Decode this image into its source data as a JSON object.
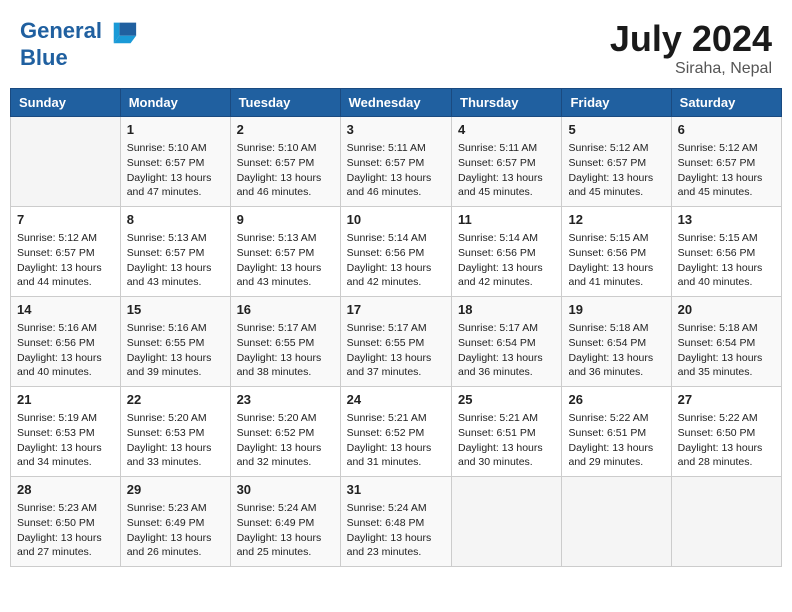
{
  "header": {
    "logo_line1": "General",
    "logo_line2": "Blue",
    "month_year": "July 2024",
    "location": "Siraha, Nepal"
  },
  "days_of_week": [
    "Sunday",
    "Monday",
    "Tuesday",
    "Wednesday",
    "Thursday",
    "Friday",
    "Saturday"
  ],
  "weeks": [
    [
      {
        "day": "",
        "sunrise": "",
        "sunset": "",
        "daylight": "",
        "empty": true
      },
      {
        "day": "1",
        "sunrise": "Sunrise: 5:10 AM",
        "sunset": "Sunset: 6:57 PM",
        "daylight": "Daylight: 13 hours and 47 minutes."
      },
      {
        "day": "2",
        "sunrise": "Sunrise: 5:10 AM",
        "sunset": "Sunset: 6:57 PM",
        "daylight": "Daylight: 13 hours and 46 minutes."
      },
      {
        "day": "3",
        "sunrise": "Sunrise: 5:11 AM",
        "sunset": "Sunset: 6:57 PM",
        "daylight": "Daylight: 13 hours and 46 minutes."
      },
      {
        "day": "4",
        "sunrise": "Sunrise: 5:11 AM",
        "sunset": "Sunset: 6:57 PM",
        "daylight": "Daylight: 13 hours and 45 minutes."
      },
      {
        "day": "5",
        "sunrise": "Sunrise: 5:12 AM",
        "sunset": "Sunset: 6:57 PM",
        "daylight": "Daylight: 13 hours and 45 minutes."
      },
      {
        "day": "6",
        "sunrise": "Sunrise: 5:12 AM",
        "sunset": "Sunset: 6:57 PM",
        "daylight": "Daylight: 13 hours and 45 minutes."
      }
    ],
    [
      {
        "day": "7",
        "sunrise": "Sunrise: 5:12 AM",
        "sunset": "Sunset: 6:57 PM",
        "daylight": "Daylight: 13 hours and 44 minutes."
      },
      {
        "day": "8",
        "sunrise": "Sunrise: 5:13 AM",
        "sunset": "Sunset: 6:57 PM",
        "daylight": "Daylight: 13 hours and 43 minutes."
      },
      {
        "day": "9",
        "sunrise": "Sunrise: 5:13 AM",
        "sunset": "Sunset: 6:57 PM",
        "daylight": "Daylight: 13 hours and 43 minutes."
      },
      {
        "day": "10",
        "sunrise": "Sunrise: 5:14 AM",
        "sunset": "Sunset: 6:56 PM",
        "daylight": "Daylight: 13 hours and 42 minutes."
      },
      {
        "day": "11",
        "sunrise": "Sunrise: 5:14 AM",
        "sunset": "Sunset: 6:56 PM",
        "daylight": "Daylight: 13 hours and 42 minutes."
      },
      {
        "day": "12",
        "sunrise": "Sunrise: 5:15 AM",
        "sunset": "Sunset: 6:56 PM",
        "daylight": "Daylight: 13 hours and 41 minutes."
      },
      {
        "day": "13",
        "sunrise": "Sunrise: 5:15 AM",
        "sunset": "Sunset: 6:56 PM",
        "daylight": "Daylight: 13 hours and 40 minutes."
      }
    ],
    [
      {
        "day": "14",
        "sunrise": "Sunrise: 5:16 AM",
        "sunset": "Sunset: 6:56 PM",
        "daylight": "Daylight: 13 hours and 40 minutes."
      },
      {
        "day": "15",
        "sunrise": "Sunrise: 5:16 AM",
        "sunset": "Sunset: 6:55 PM",
        "daylight": "Daylight: 13 hours and 39 minutes."
      },
      {
        "day": "16",
        "sunrise": "Sunrise: 5:17 AM",
        "sunset": "Sunset: 6:55 PM",
        "daylight": "Daylight: 13 hours and 38 minutes."
      },
      {
        "day": "17",
        "sunrise": "Sunrise: 5:17 AM",
        "sunset": "Sunset: 6:55 PM",
        "daylight": "Daylight: 13 hours and 37 minutes."
      },
      {
        "day": "18",
        "sunrise": "Sunrise: 5:17 AM",
        "sunset": "Sunset: 6:54 PM",
        "daylight": "Daylight: 13 hours and 36 minutes."
      },
      {
        "day": "19",
        "sunrise": "Sunrise: 5:18 AM",
        "sunset": "Sunset: 6:54 PM",
        "daylight": "Daylight: 13 hours and 36 minutes."
      },
      {
        "day": "20",
        "sunrise": "Sunrise: 5:18 AM",
        "sunset": "Sunset: 6:54 PM",
        "daylight": "Daylight: 13 hours and 35 minutes."
      }
    ],
    [
      {
        "day": "21",
        "sunrise": "Sunrise: 5:19 AM",
        "sunset": "Sunset: 6:53 PM",
        "daylight": "Daylight: 13 hours and 34 minutes."
      },
      {
        "day": "22",
        "sunrise": "Sunrise: 5:20 AM",
        "sunset": "Sunset: 6:53 PM",
        "daylight": "Daylight: 13 hours and 33 minutes."
      },
      {
        "day": "23",
        "sunrise": "Sunrise: 5:20 AM",
        "sunset": "Sunset: 6:52 PM",
        "daylight": "Daylight: 13 hours and 32 minutes."
      },
      {
        "day": "24",
        "sunrise": "Sunrise: 5:21 AM",
        "sunset": "Sunset: 6:52 PM",
        "daylight": "Daylight: 13 hours and 31 minutes."
      },
      {
        "day": "25",
        "sunrise": "Sunrise: 5:21 AM",
        "sunset": "Sunset: 6:51 PM",
        "daylight": "Daylight: 13 hours and 30 minutes."
      },
      {
        "day": "26",
        "sunrise": "Sunrise: 5:22 AM",
        "sunset": "Sunset: 6:51 PM",
        "daylight": "Daylight: 13 hours and 29 minutes."
      },
      {
        "day": "27",
        "sunrise": "Sunrise: 5:22 AM",
        "sunset": "Sunset: 6:50 PM",
        "daylight": "Daylight: 13 hours and 28 minutes."
      }
    ],
    [
      {
        "day": "28",
        "sunrise": "Sunrise: 5:23 AM",
        "sunset": "Sunset: 6:50 PM",
        "daylight": "Daylight: 13 hours and 27 minutes."
      },
      {
        "day": "29",
        "sunrise": "Sunrise: 5:23 AM",
        "sunset": "Sunset: 6:49 PM",
        "daylight": "Daylight: 13 hours and 26 minutes."
      },
      {
        "day": "30",
        "sunrise": "Sunrise: 5:24 AM",
        "sunset": "Sunset: 6:49 PM",
        "daylight": "Daylight: 13 hours and 25 minutes."
      },
      {
        "day": "31",
        "sunrise": "Sunrise: 5:24 AM",
        "sunset": "Sunset: 6:48 PM",
        "daylight": "Daylight: 13 hours and 23 minutes."
      },
      {
        "day": "",
        "empty": true
      },
      {
        "day": "",
        "empty": true
      },
      {
        "day": "",
        "empty": true
      }
    ]
  ]
}
